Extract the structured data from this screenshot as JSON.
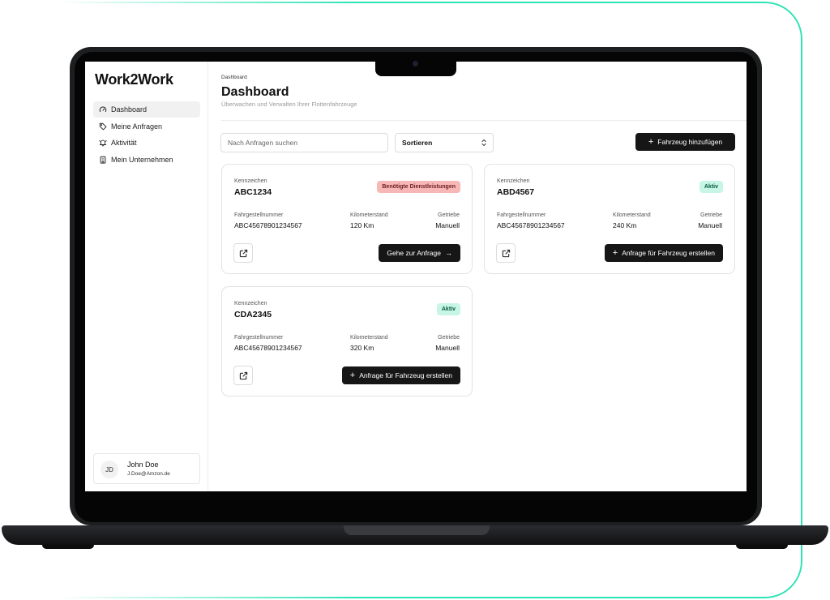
{
  "app": {
    "title": "Work2Work"
  },
  "sidebar": {
    "items": [
      {
        "label": "Dashboard",
        "icon": "gauge-icon",
        "active": true
      },
      {
        "label": "Meine Anfragen",
        "icon": "tag-icon",
        "active": false
      },
      {
        "label": "Aktivität",
        "icon": "bell-icon",
        "active": false
      },
      {
        "label": "Mein Unternehmen",
        "icon": "building-icon",
        "active": false
      }
    ],
    "user": {
      "initials": "JD",
      "name": "John Doe",
      "email": "J.Doe@Amzon.de"
    }
  },
  "header": {
    "breadcrumb": "Dashboard",
    "title": "Dashboard",
    "subtitle": "Überwachen und Verwalten Ihrer Flottenfahrzeuge"
  },
  "toolbar": {
    "search_placeholder": "Nach Anfragen suchen",
    "sort_label": "Sortieren",
    "add_label": "Fahrzeug hinzufügen"
  },
  "labels": {
    "plate": "Kennzeichen",
    "vin": "Fahrgestellnummer",
    "mileage": "Kilometerstand",
    "gearbox": "Getriebe"
  },
  "vehicles": [
    {
      "plate": "ABC1234",
      "status": "Benötigte Dienstleistungen",
      "status_kind": "warning",
      "vin": "ABC45678901234567",
      "mileage": "120 Km",
      "gearbox": "Manuell",
      "action": "Gehe zur Anfrage"
    },
    {
      "plate": "ABD4567",
      "status": "Aktiv",
      "status_kind": "active",
      "vin": "ABC45678901234567",
      "mileage": "240 Km",
      "gearbox": "Manuell",
      "action": "Anfrage für Fahrzeug erstellen"
    },
    {
      "plate": "CDA2345",
      "status": "Aktiv",
      "status_kind": "active",
      "vin": "ABC45678901234567",
      "mileage": "320 Km",
      "gearbox": "Manuell",
      "action": "Anfrage für Fahrzeug erstellen"
    }
  ],
  "colors": {
    "accent_frame": "#2be3b4",
    "button_dark": "#161616",
    "badge_warning": "#f8b7b7",
    "badge_active": "#c7f5e6"
  }
}
